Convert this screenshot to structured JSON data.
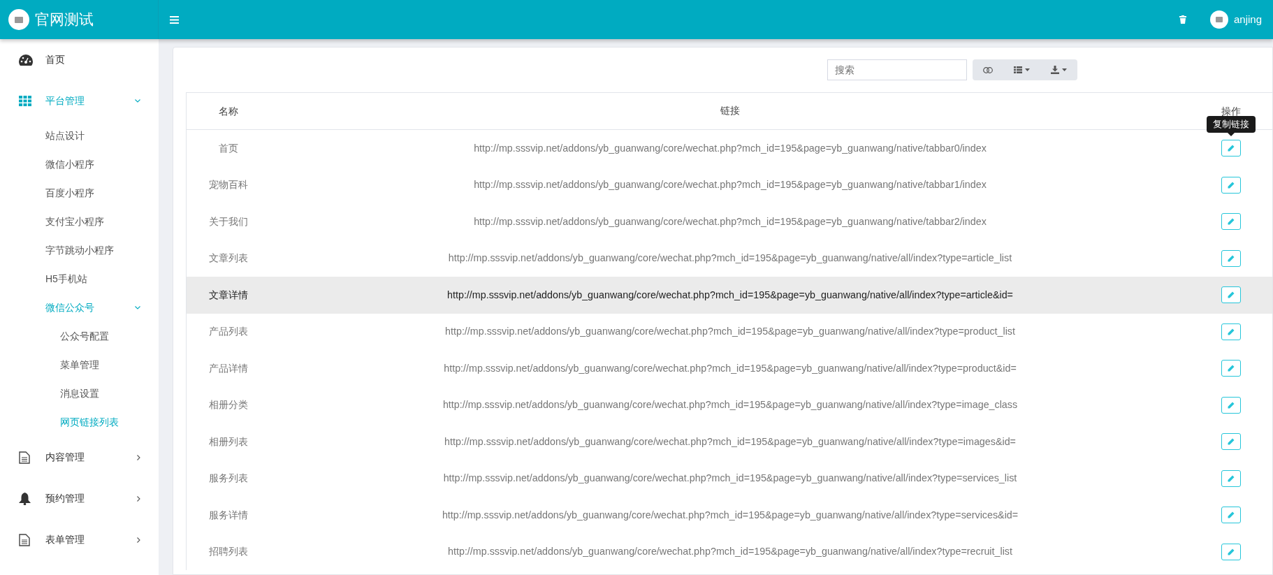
{
  "header": {
    "site_title": "官网测试",
    "user_name": "anjing"
  },
  "sidebar": {
    "items": [
      {
        "label": "首页",
        "selected": false
      },
      {
        "label": "平台管理",
        "selected": true,
        "expanded": true,
        "children": [
          {
            "label": "站点设计",
            "selected": false
          },
          {
            "label": "微信小程序",
            "selected": false
          },
          {
            "label": "百度小程序",
            "selected": false
          },
          {
            "label": "支付宝小程序",
            "selected": false
          },
          {
            "label": "字节跳动小程序",
            "selected": false
          },
          {
            "label": "H5手机站",
            "selected": false
          },
          {
            "label": "微信公众号",
            "selected": true,
            "expanded": true,
            "children": [
              {
                "label": "公众号配置",
                "selected": false
              },
              {
                "label": "菜单管理",
                "selected": false
              },
              {
                "label": "消息设置",
                "selected": false
              },
              {
                "label": "网页链接列表",
                "selected": true
              }
            ]
          }
        ]
      },
      {
        "label": "内容管理",
        "selected": false,
        "expanded": false
      },
      {
        "label": "预约管理",
        "selected": false,
        "expanded": false
      },
      {
        "label": "表单管理",
        "selected": false,
        "expanded": false
      }
    ]
  },
  "toolbar": {
    "search": {
      "placeholder": "搜索"
    }
  },
  "table": {
    "columns": [
      "名称",
      "链接",
      "操作"
    ],
    "tooltip": "复制链接",
    "rows": [
      {
        "name": "首页",
        "link": "http://mp.sssvip.net/addons/yb_guanwang/core/wechat.php?mch_id=195&page=yb_guanwang/native/tabbar0/index",
        "selected": false
      },
      {
        "name": "宠物百科",
        "link": "http://mp.sssvip.net/addons/yb_guanwang/core/wechat.php?mch_id=195&page=yb_guanwang/native/tabbar1/index",
        "selected": false
      },
      {
        "name": "关于我们",
        "link": "http://mp.sssvip.net/addons/yb_guanwang/core/wechat.php?mch_id=195&page=yb_guanwang/native/tabbar2/index",
        "selected": false
      },
      {
        "name": "文章列表",
        "link": "http://mp.sssvip.net/addons/yb_guanwang/core/wechat.php?mch_id=195&page=yb_guanwang/native/all/index?type=article_list",
        "selected": false
      },
      {
        "name": "文章详情",
        "link": "http://mp.sssvip.net/addons/yb_guanwang/core/wechat.php?mch_id=195&page=yb_guanwang/native/all/index?type=article&id=",
        "selected": true
      },
      {
        "name": "产品列表",
        "link": "http://mp.sssvip.net/addons/yb_guanwang/core/wechat.php?mch_id=195&page=yb_guanwang/native/all/index?type=product_list",
        "selected": false
      },
      {
        "name": "产品详情",
        "link": "http://mp.sssvip.net/addons/yb_guanwang/core/wechat.php?mch_id=195&page=yb_guanwang/native/all/index?type=product&id=",
        "selected": false
      },
      {
        "name": "相册分类",
        "link": "http://mp.sssvip.net/addons/yb_guanwang/core/wechat.php?mch_id=195&page=yb_guanwang/native/all/index?type=image_class",
        "selected": false
      },
      {
        "name": "相册列表",
        "link": "http://mp.sssvip.net/addons/yb_guanwang/core/wechat.php?mch_id=195&page=yb_guanwang/native/all/index?type=images&id=",
        "selected": false
      },
      {
        "name": "服务列表",
        "link": "http://mp.sssvip.net/addons/yb_guanwang/core/wechat.php?mch_id=195&page=yb_guanwang/native/all/index?type=services_list",
        "selected": false
      },
      {
        "name": "服务详情",
        "link": "http://mp.sssvip.net/addons/yb_guanwang/core/wechat.php?mch_id=195&page=yb_guanwang/native/all/index?type=services&id=",
        "selected": false
      },
      {
        "name": "招聘列表",
        "link": "http://mp.sssvip.net/addons/yb_guanwang/core/wechat.php?mch_id=195&page=yb_guanwang/native/all/index?type=recruit_list",
        "selected": false
      }
    ]
  }
}
